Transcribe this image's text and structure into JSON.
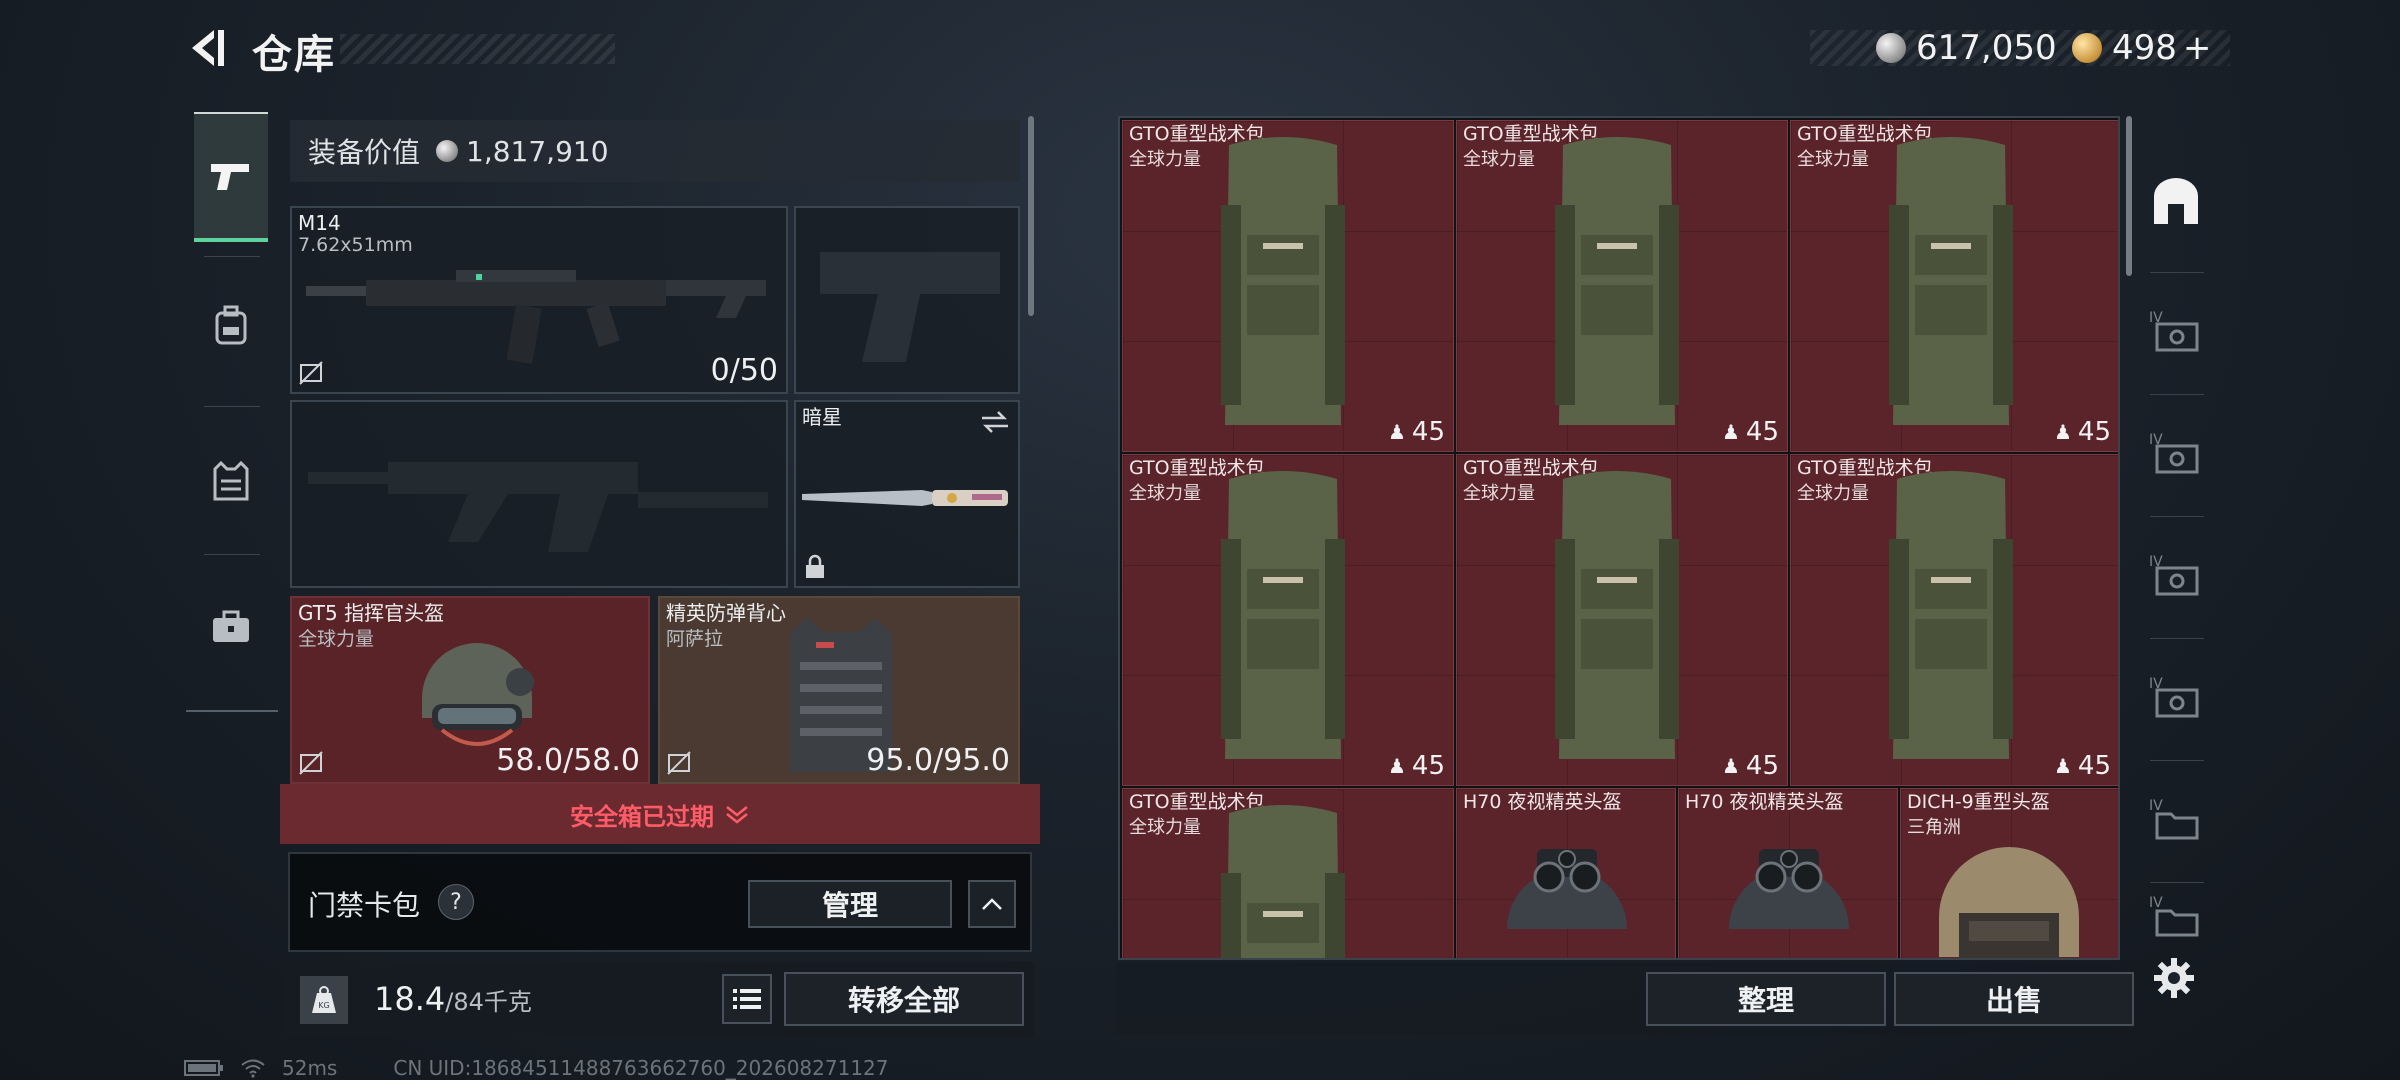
{
  "header": {
    "title": "仓库",
    "currency_silver": "617,050",
    "currency_gold": "498",
    "gold_add": "+"
  },
  "equipment": {
    "value_label": "装备价值",
    "value": "1,817,910",
    "primary_weapon": {
      "name": "M14",
      "caliber": "7.62x51mm",
      "ammo": "0/50"
    },
    "melee": {
      "name": "暗星"
    },
    "helmet": {
      "name": "GT5 指挥官头盔",
      "sub": "全球力量",
      "durability": "58.0/58.0"
    },
    "armor": {
      "name": "精英防弹背心",
      "sub": "阿萨拉",
      "durability": "95.0/95.0"
    }
  },
  "safebox": {
    "expired_text": "安全箱已过期"
  },
  "keycard": {
    "label": "门禁卡包",
    "help": "?",
    "manage": "管理"
  },
  "weight": {
    "current": "18.4",
    "max": "/84千克"
  },
  "actions": {
    "transfer_all": "转移全部",
    "sort": "整理",
    "sell": "出售"
  },
  "stash": {
    "items": [
      {
        "name": "GTO重型战术包",
        "sub": "全球力量",
        "count": "45"
      },
      {
        "name": "GTO重型战术包",
        "sub": "全球力量",
        "count": "45"
      },
      {
        "name": "GTO重型战术包",
        "sub": "全球力量",
        "count": "45"
      },
      {
        "name": "GTO重型战术包",
        "sub": "全球力量",
        "count": "45"
      },
      {
        "name": "GTO重型战术包",
        "sub": "全球力量",
        "count": "45"
      },
      {
        "name": "GTO重型战术包",
        "sub": "全球力量",
        "count": "45"
      },
      {
        "name": "GTO重型战术包",
        "sub": "全球力量",
        "count": ""
      },
      {
        "name": "H70 夜视精英头盔",
        "sub": "",
        "count": ""
      },
      {
        "name": "H70 夜视精英头盔",
        "sub": "",
        "count": ""
      },
      {
        "name": "DICH-9重型头盔",
        "sub": "三角洲",
        "count": ""
      }
    ]
  },
  "footer": {
    "ping": "52ms",
    "uid": "CN UID:18684511488763662760_202608271127"
  },
  "colors": {
    "accent_green": "#5fd29e",
    "alert_red": "#ff5c68",
    "cell_red": "#5b242a"
  }
}
